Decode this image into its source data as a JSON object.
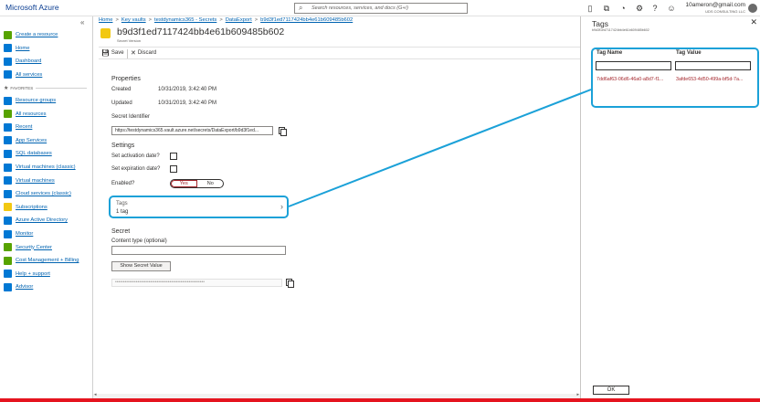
{
  "topbar": {
    "brand": "Microsoft Azure",
    "search_placeholder": "Search resources, services, and docs (G+/)",
    "account_email": "10ameron@gmail.com",
    "account_org": "UDS CONSULTING LLC"
  },
  "sidebar": {
    "items_top": [
      {
        "label": "Create a resource",
        "icon": "plus-icon",
        "color": "#57a300"
      },
      {
        "label": "Home",
        "icon": "home-icon",
        "color": "#0078d4"
      },
      {
        "label": "Dashboard",
        "icon": "dashboard-icon",
        "color": "#0078d4"
      },
      {
        "label": "All services",
        "icon": "list-icon",
        "color": "#0078d4"
      }
    ],
    "favorites_label": "FAVORITES",
    "items_fav": [
      {
        "label": "Resource groups",
        "icon": "resource-groups-icon",
        "color": "#0078d4"
      },
      {
        "label": "All resources",
        "icon": "grid-icon",
        "color": "#57a300"
      },
      {
        "label": "Recent",
        "icon": "clock-icon",
        "color": "#0078d4"
      },
      {
        "label": "App Services",
        "icon": "globe-icon",
        "color": "#0078d4"
      },
      {
        "label": "SQL databases",
        "icon": "database-icon",
        "color": "#0078d4"
      },
      {
        "label": "Virtual machines (classic)",
        "icon": "vm-classic-icon",
        "color": "#0078d4"
      },
      {
        "label": "Virtual machines",
        "icon": "vm-icon",
        "color": "#0078d4"
      },
      {
        "label": "Cloud services (classic)",
        "icon": "cloud-icon",
        "color": "#0078d4"
      },
      {
        "label": "Subscriptions",
        "icon": "key-icon",
        "color": "#f2c811"
      },
      {
        "label": "Azure Active Directory",
        "icon": "aad-icon",
        "color": "#0078d4"
      },
      {
        "label": "Monitor",
        "icon": "monitor-icon",
        "color": "#0078d4"
      },
      {
        "label": "Security Center",
        "icon": "shield-icon",
        "color": "#57a300"
      },
      {
        "label": "Cost Management + Billing",
        "icon": "billing-icon",
        "color": "#57a300"
      },
      {
        "label": "Help + support",
        "icon": "person-icon",
        "color": "#0078d4"
      },
      {
        "label": "Advisor",
        "icon": "advisor-icon",
        "color": "#0078d4"
      }
    ]
  },
  "breadcrumb": {
    "items": [
      "Home",
      "Key vaults",
      "testdynamics365 - Secrets",
      "DataExport",
      "b9d3f1ed7117424bb4e61b609485b602"
    ],
    "separator": ">"
  },
  "blade": {
    "title": "b9d3f1ed7117424bb4e61b609485b602",
    "subtitle": "Secret Version",
    "save_label": "Save",
    "discard_label": "Discard"
  },
  "properties": {
    "section_label": "Properties",
    "created_label": "Created",
    "created_value": "10/31/2019, 3:42:40 PM",
    "updated_label": "Updated",
    "updated_value": "10/31/2019, 3:42:40 PM",
    "secret_id_label": "Secret Identifier",
    "secret_id_value": "https://testdynamics365.vault.azure.net/secrets/DataExport/b9d3f1ed..."
  },
  "settings": {
    "section_label": "Settings",
    "activation_label": "Set activation date?",
    "expiration_label": "Set expiration date?",
    "enabled_label": "Enabled?",
    "yes_label": "Yes",
    "no_label": "No"
  },
  "tags_row": {
    "label": "Tags",
    "count": "1 tag"
  },
  "secret": {
    "section_label": "Secret",
    "content_type_label": "Content type (optional)",
    "show_button": "Show Secret Value",
    "masked_value": "••••••••••••••••••••••••••••••••••••••••••••••••••••••••"
  },
  "tags_panel": {
    "title": "Tags",
    "subtitle": "b9d3f1ed7117424bb4e61b609485b602",
    "col_name": "Tag Name",
    "col_value": "Tag Value",
    "row_name": "7dd6af63-06d6-46a0-a8d7-f1...",
    "row_value": "3afde653-4d50-499a-bf5d-7a...",
    "ok_label": "OK"
  },
  "colors": {
    "highlight": "#1ba1d8",
    "link": "#0063b1",
    "error": "#a4262c",
    "bottom_bar": "#e5141f"
  }
}
